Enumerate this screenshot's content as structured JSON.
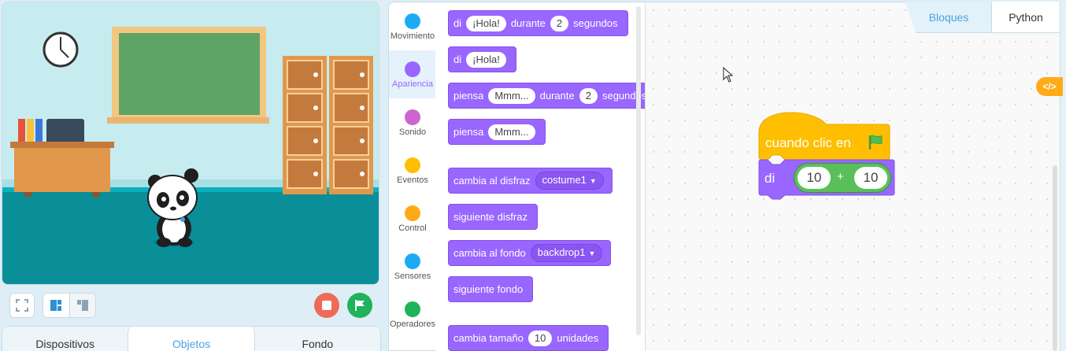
{
  "stage": {
    "scene": "classroom",
    "sprite": "panda"
  },
  "stage_controls": {
    "fullscreen_icon": "fullscreen-icon",
    "layout_icons": [
      "layout-split-icon",
      "layout-small-icon"
    ],
    "stop_icon": "stop-icon",
    "go_icon": "green-flag-icon",
    "colors": {
      "stop": "#ee6b57",
      "go": "#1fb35b"
    }
  },
  "bottom_tabs": [
    {
      "label": "Dispositivos",
      "active": false
    },
    {
      "label": "Objetos",
      "active": true
    },
    {
      "label": "Fondo",
      "active": false
    }
  ],
  "categories": [
    {
      "label": "Movimiento",
      "color": "#1cabf2",
      "active": false
    },
    {
      "label": "Apariencia",
      "color": "#9966ff",
      "active": true
    },
    {
      "label": "Sonido",
      "color": "#cf63cf",
      "active": false
    },
    {
      "label": "Eventos",
      "color": "#ffbf00",
      "active": false
    },
    {
      "label": "Control",
      "color": "#ffab19",
      "active": false
    },
    {
      "label": "Sensores",
      "color": "#1cabf2",
      "active": false
    },
    {
      "label": "Operadores",
      "color": "#1fb35b",
      "active": false
    }
  ],
  "palette": {
    "say_for_secs": {
      "word1": "di",
      "arg1": "¡Hola!",
      "word2": "durante",
      "arg2": "2",
      "word3": "segundos"
    },
    "say": {
      "word1": "di",
      "arg1": "¡Hola!"
    },
    "think_for_secs": {
      "word1": "piensa",
      "arg1": "Mmm...",
      "word2": "durante",
      "arg2": "2",
      "word3": "segundos"
    },
    "think": {
      "word1": "piensa",
      "arg1": "Mmm..."
    },
    "switch_costume": {
      "word1": "cambia al disfraz",
      "arg1": "costume1"
    },
    "next_costume": {
      "word1": "siguiente disfraz"
    },
    "switch_backdrop": {
      "word1": "cambia al fondo",
      "arg1": "backdrop1"
    },
    "next_backdrop": {
      "word1": "siguiente fondo"
    },
    "change_size": {
      "word1": "cambia tamaño",
      "arg1": "10",
      "word2": "unidades"
    }
  },
  "code_tabs": {
    "blocks": "Bloques",
    "python": "Python"
  },
  "code_toggle_label": "</>",
  "script": {
    "hat_label": "cuando clic en",
    "say_label": "di",
    "operand1": "10",
    "operator": "+",
    "operand2": "10",
    "colors": {
      "events": "#ffbf00",
      "looks": "#9966ff",
      "operators": "#59c059"
    }
  }
}
